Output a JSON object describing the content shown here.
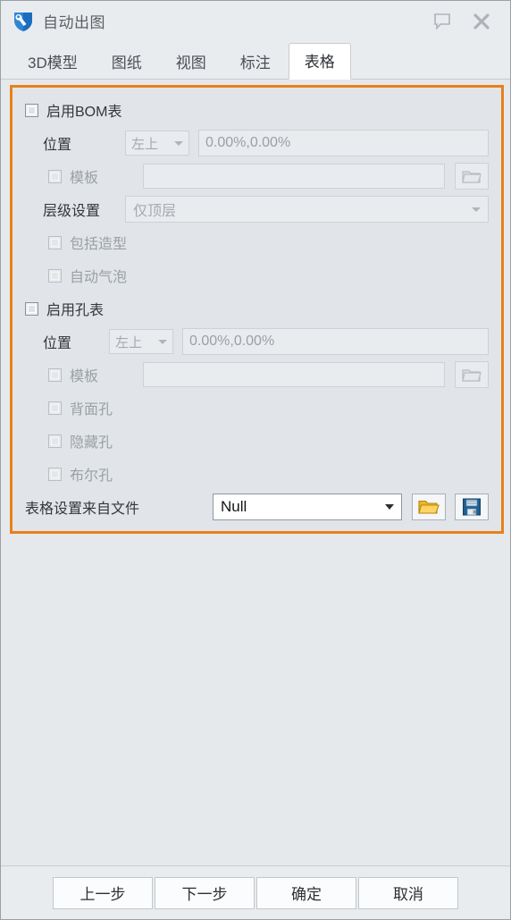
{
  "window": {
    "title": "自动出图",
    "app_icon": "app-shield-wrench-icon",
    "comment_button": "comment-icon",
    "close_button": "close-icon"
  },
  "tabs": [
    {
      "label": "3D模型",
      "active": false
    },
    {
      "label": "图纸",
      "active": false
    },
    {
      "label": "视图",
      "active": false
    },
    {
      "label": "标注",
      "active": false
    },
    {
      "label": "表格",
      "active": true
    }
  ],
  "panel": {
    "accent_color": "#e8811a",
    "bom": {
      "enable_label": "启用BOM表",
      "position_label": "位置",
      "position_value": "左上",
      "coords_value": "0.00%,0.00%",
      "template_label": "模板",
      "template_value": "",
      "browse_icon": "folder-open-icon",
      "level_label": "层级设置",
      "level_value": "仅顶层",
      "include_shape_label": "包括造型",
      "auto_balloon_label": "自动气泡"
    },
    "hole": {
      "enable_label": "启用孔表",
      "position_label": "位置",
      "position_value": "左上",
      "coords_value": "0.00%,0.00%",
      "template_label": "模板",
      "template_value": "",
      "browse_icon": "folder-open-icon",
      "back_hole_label": "背面孔",
      "hidden_hole_label": "隐藏孔",
      "boolean_hole_label": "布尔孔"
    },
    "settings_file": {
      "label": "表格设置来自文件",
      "value": "Null",
      "open_icon": "folder-open-icon",
      "save_icon": "floppy-save-icon"
    }
  },
  "footer": {
    "prev": "上一步",
    "next": "下一步",
    "ok": "确定",
    "cancel": "取消"
  }
}
